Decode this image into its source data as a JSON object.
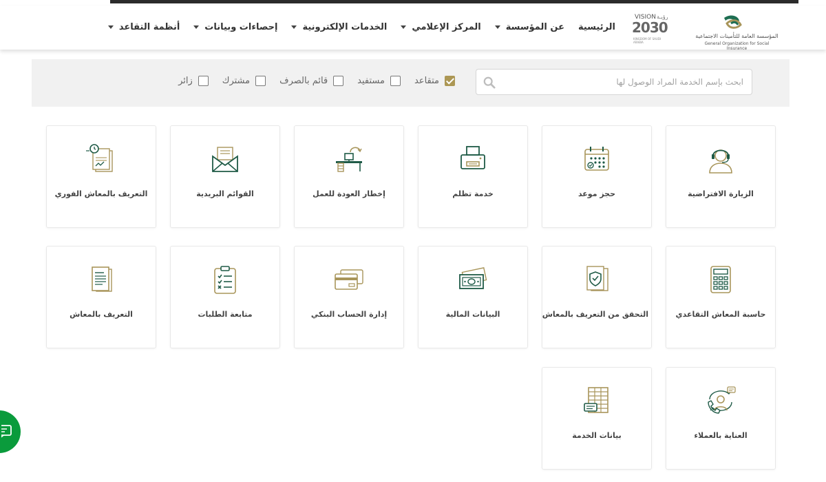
{
  "header": {
    "gosi_arabic": "المؤسسة العامة للتأمينات الاجتماعية",
    "gosi_english": "General Organization for Social Insurance",
    "vision_word": "VISION",
    "vision_arabic": "رؤيـة",
    "vision_year": "2030",
    "vision_sub": "KINGDOM OF SAUDI ARABIA",
    "nav": [
      {
        "label": "الرئيسية",
        "has_dropdown": false
      },
      {
        "label": "عن المؤسسة",
        "has_dropdown": true
      },
      {
        "label": "المركز الإعلامي",
        "has_dropdown": true
      },
      {
        "label": "الخدمات الإلكترونية",
        "has_dropdown": true
      },
      {
        "label": "إحصاءات وبيانات",
        "has_dropdown": true
      },
      {
        "label": "أنظمة التقاعد",
        "has_dropdown": true
      }
    ]
  },
  "filters": {
    "search_placeholder": "ابحث بإسم الخدمة المراد الوصول لها",
    "search_value": "",
    "checkboxes": [
      {
        "label": "متقاعد",
        "checked": true
      },
      {
        "label": "مستفيد",
        "checked": false
      },
      {
        "label": "قائم بالصرف",
        "checked": false
      },
      {
        "label": "مشترك",
        "checked": false
      },
      {
        "label": "زائر",
        "checked": false
      }
    ]
  },
  "services": [
    {
      "label": "الزيارة الافتراضية",
      "icon": "headset-agent-icon"
    },
    {
      "label": "حجز موعد",
      "icon": "calendar-icon"
    },
    {
      "label": "خدمة تظلم",
      "icon": "printer-icon"
    },
    {
      "label": "إخطار العودة للعمل",
      "icon": "desk-return-icon"
    },
    {
      "label": "القوائم البريدية",
      "icon": "mail-envelope-icon"
    },
    {
      "label": "التعريف بالمعاش الفوري",
      "icon": "document-clock-icon"
    },
    {
      "label": "حاسبة المعاش التقاعدي",
      "icon": "calculator-icon"
    },
    {
      "label": "التحقق من التعريف بالمعاش",
      "icon": "document-shield-icon"
    },
    {
      "label": "البيانات المالية",
      "icon": "money-bills-icon"
    },
    {
      "label": "إدارة الحساب البنكي",
      "icon": "bank-cards-icon"
    },
    {
      "label": "متابعة الطلبات",
      "icon": "clipboard-checklist-icon"
    },
    {
      "label": "التعريف بالمعاش",
      "icon": "documents-icon"
    },
    {
      "label": "العناية بالعملاء",
      "icon": "customer-care-icon"
    },
    {
      "label": "بيانات الخدمة",
      "icon": "data-sheet-icon"
    }
  ],
  "colors": {
    "icon_gold": "#a8955a",
    "icon_green": "#1e5a46",
    "checkbox_checked": "#ac9754",
    "chat_green": "#0a9b3c"
  },
  "chat": {
    "icon": "chat-bubble-icon"
  }
}
